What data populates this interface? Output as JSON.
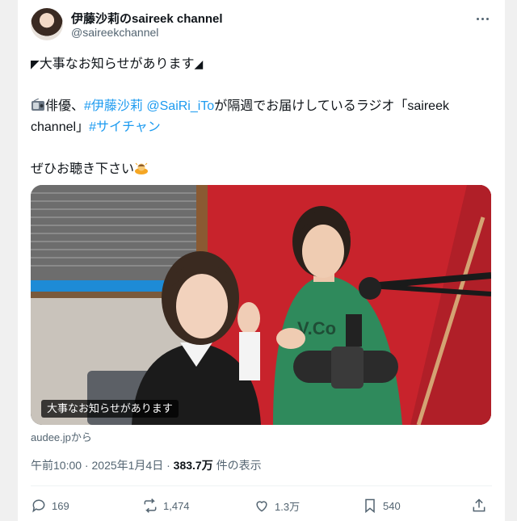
{
  "header": {
    "display_name": "伊藤沙莉のsaireek channel",
    "handle": "@saireekchannel"
  },
  "tweet": {
    "line1": "大事なお知らせがあります",
    "line2_prefix": "俳優、",
    "hashtag_name": "#伊藤沙莉",
    "mention": "@SaiRi_iTo",
    "line2_suffix": "が隔週でお届けしているラジオ「saireek",
    "line3_prefix": "channel」",
    "hashtag_saichan": "#サイチャン",
    "line4": "ぜひお聴き下さい"
  },
  "media": {
    "caption": "大事なお知らせがあります"
  },
  "source": "audee.jpから",
  "meta": {
    "time": "午前10:00",
    "separator1": " · ",
    "date": "2025年1月4日",
    "separator2": " · ",
    "views_count": "383.7万",
    "views_label": " 件の表示"
  },
  "actions": {
    "replies": "169",
    "reposts": "1,474",
    "likes": "1.3万",
    "bookmarks": "540"
  },
  "icons": {
    "more": "more-dots-icon",
    "reply": "reply-icon",
    "repost": "repost-icon",
    "like": "heart-icon",
    "bookmark": "bookmark-icon",
    "share": "share-icon",
    "radio": "radio-emoji-icon",
    "bow": "bowing-person-emoji-icon"
  },
  "colors": {
    "link": "#1d9bf0",
    "text": "#0f1419",
    "secondary": "#536471"
  }
}
